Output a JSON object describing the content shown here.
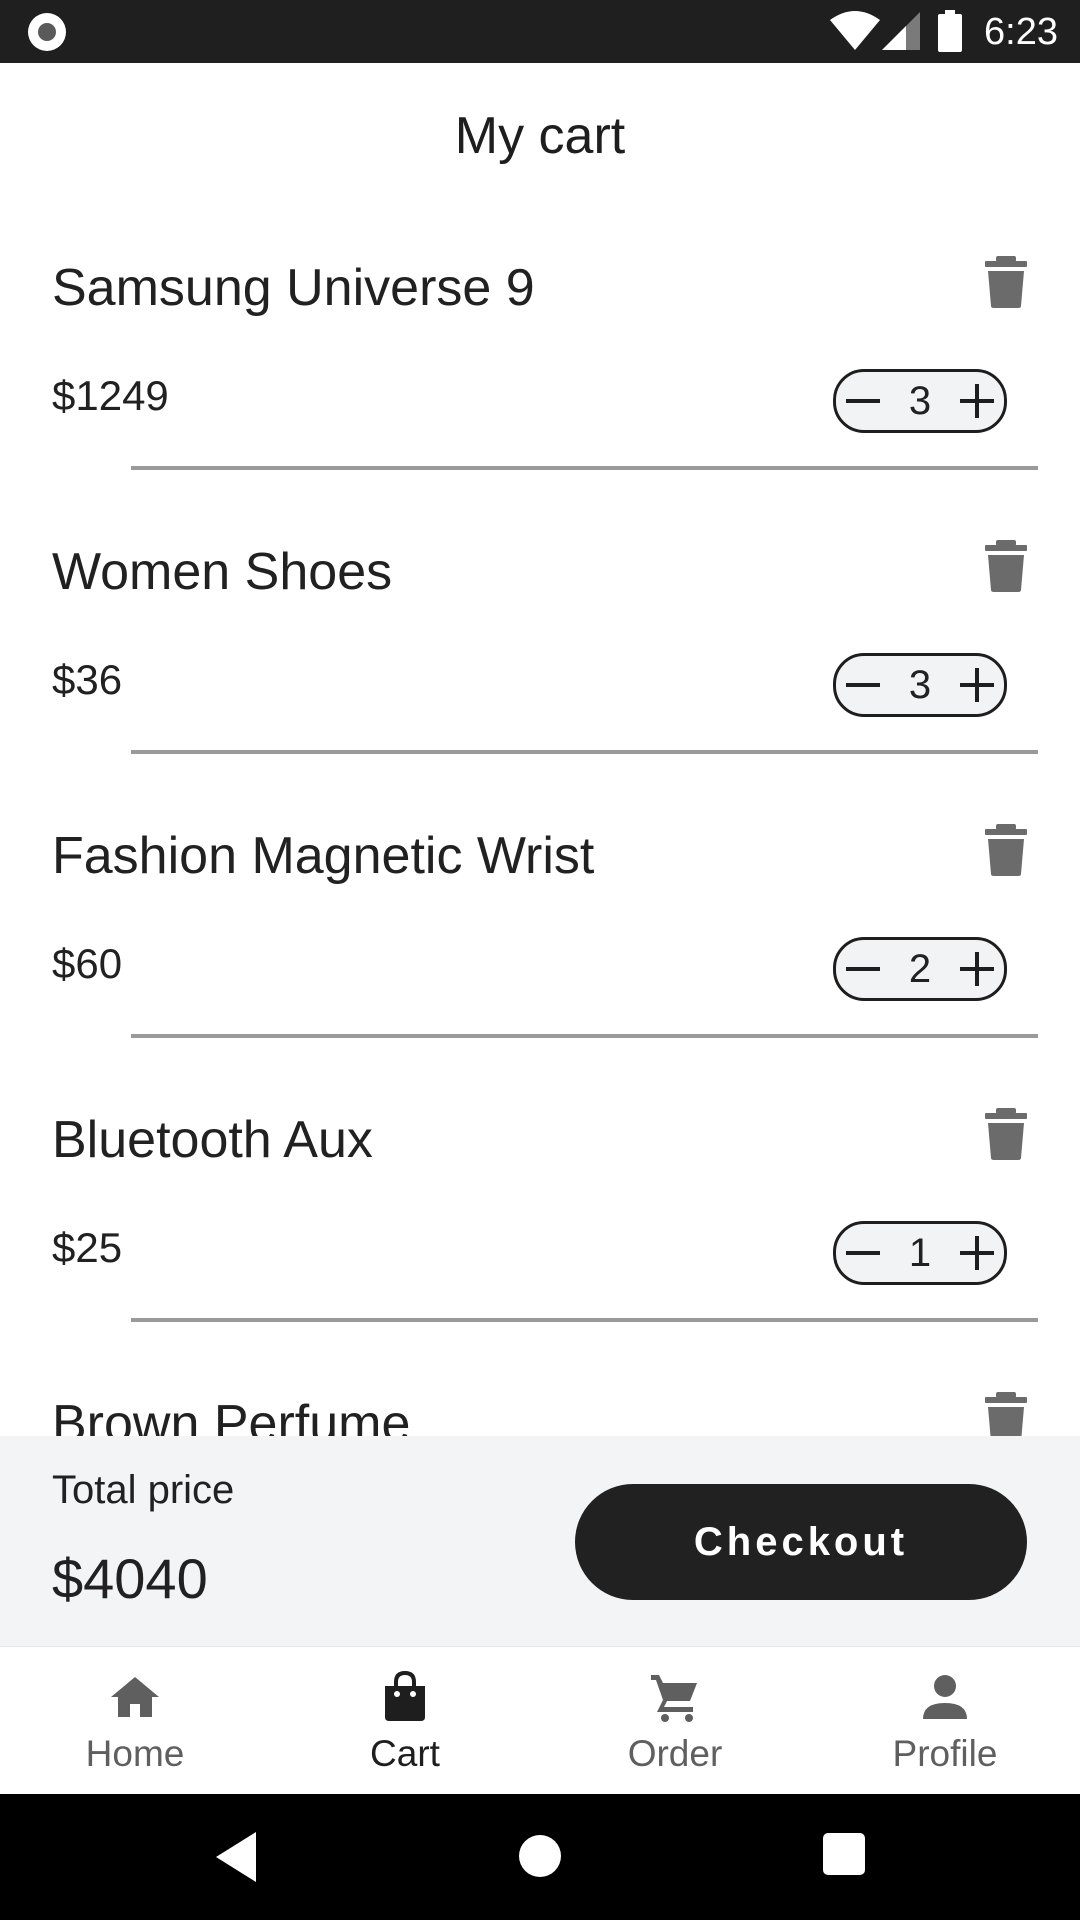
{
  "status_bar": {
    "time": "6:23",
    "icons": [
      "recording-dot-icon",
      "wifi-icon",
      "cell-signal-icon",
      "battery-icon"
    ]
  },
  "page": {
    "title": "My cart"
  },
  "cart": {
    "items": [
      {
        "name": "Samsung Universe 9",
        "price": "$1249",
        "quantity": "3"
      },
      {
        "name": "Women Shoes",
        "price": "$36",
        "quantity": "3"
      },
      {
        "name": "Fashion Magnetic Wrist",
        "price": "$60",
        "quantity": "2"
      },
      {
        "name": "Bluetooth Aux",
        "price": "$25",
        "quantity": "1"
      },
      {
        "name": "Brown Perfume",
        "price": "",
        "quantity": ""
      }
    ]
  },
  "summary": {
    "total_label": "Total price",
    "total_value": "$4040",
    "checkout_label": "Checkout"
  },
  "bottom_nav": {
    "items": [
      {
        "label": "Home",
        "icon": "home-icon",
        "active": false
      },
      {
        "label": "Cart",
        "icon": "shopping-bag-icon",
        "active": true
      },
      {
        "label": "Order",
        "icon": "cart-icon",
        "active": false
      },
      {
        "label": "Profile",
        "icon": "person-icon",
        "active": false
      }
    ]
  },
  "colors": {
    "primary": "#212121",
    "icon_gray": "#6b6b6b",
    "divider": "#9a9a9a",
    "panel_bg": "#f3f4f6",
    "inactive_nav": "#5f5f5f"
  }
}
